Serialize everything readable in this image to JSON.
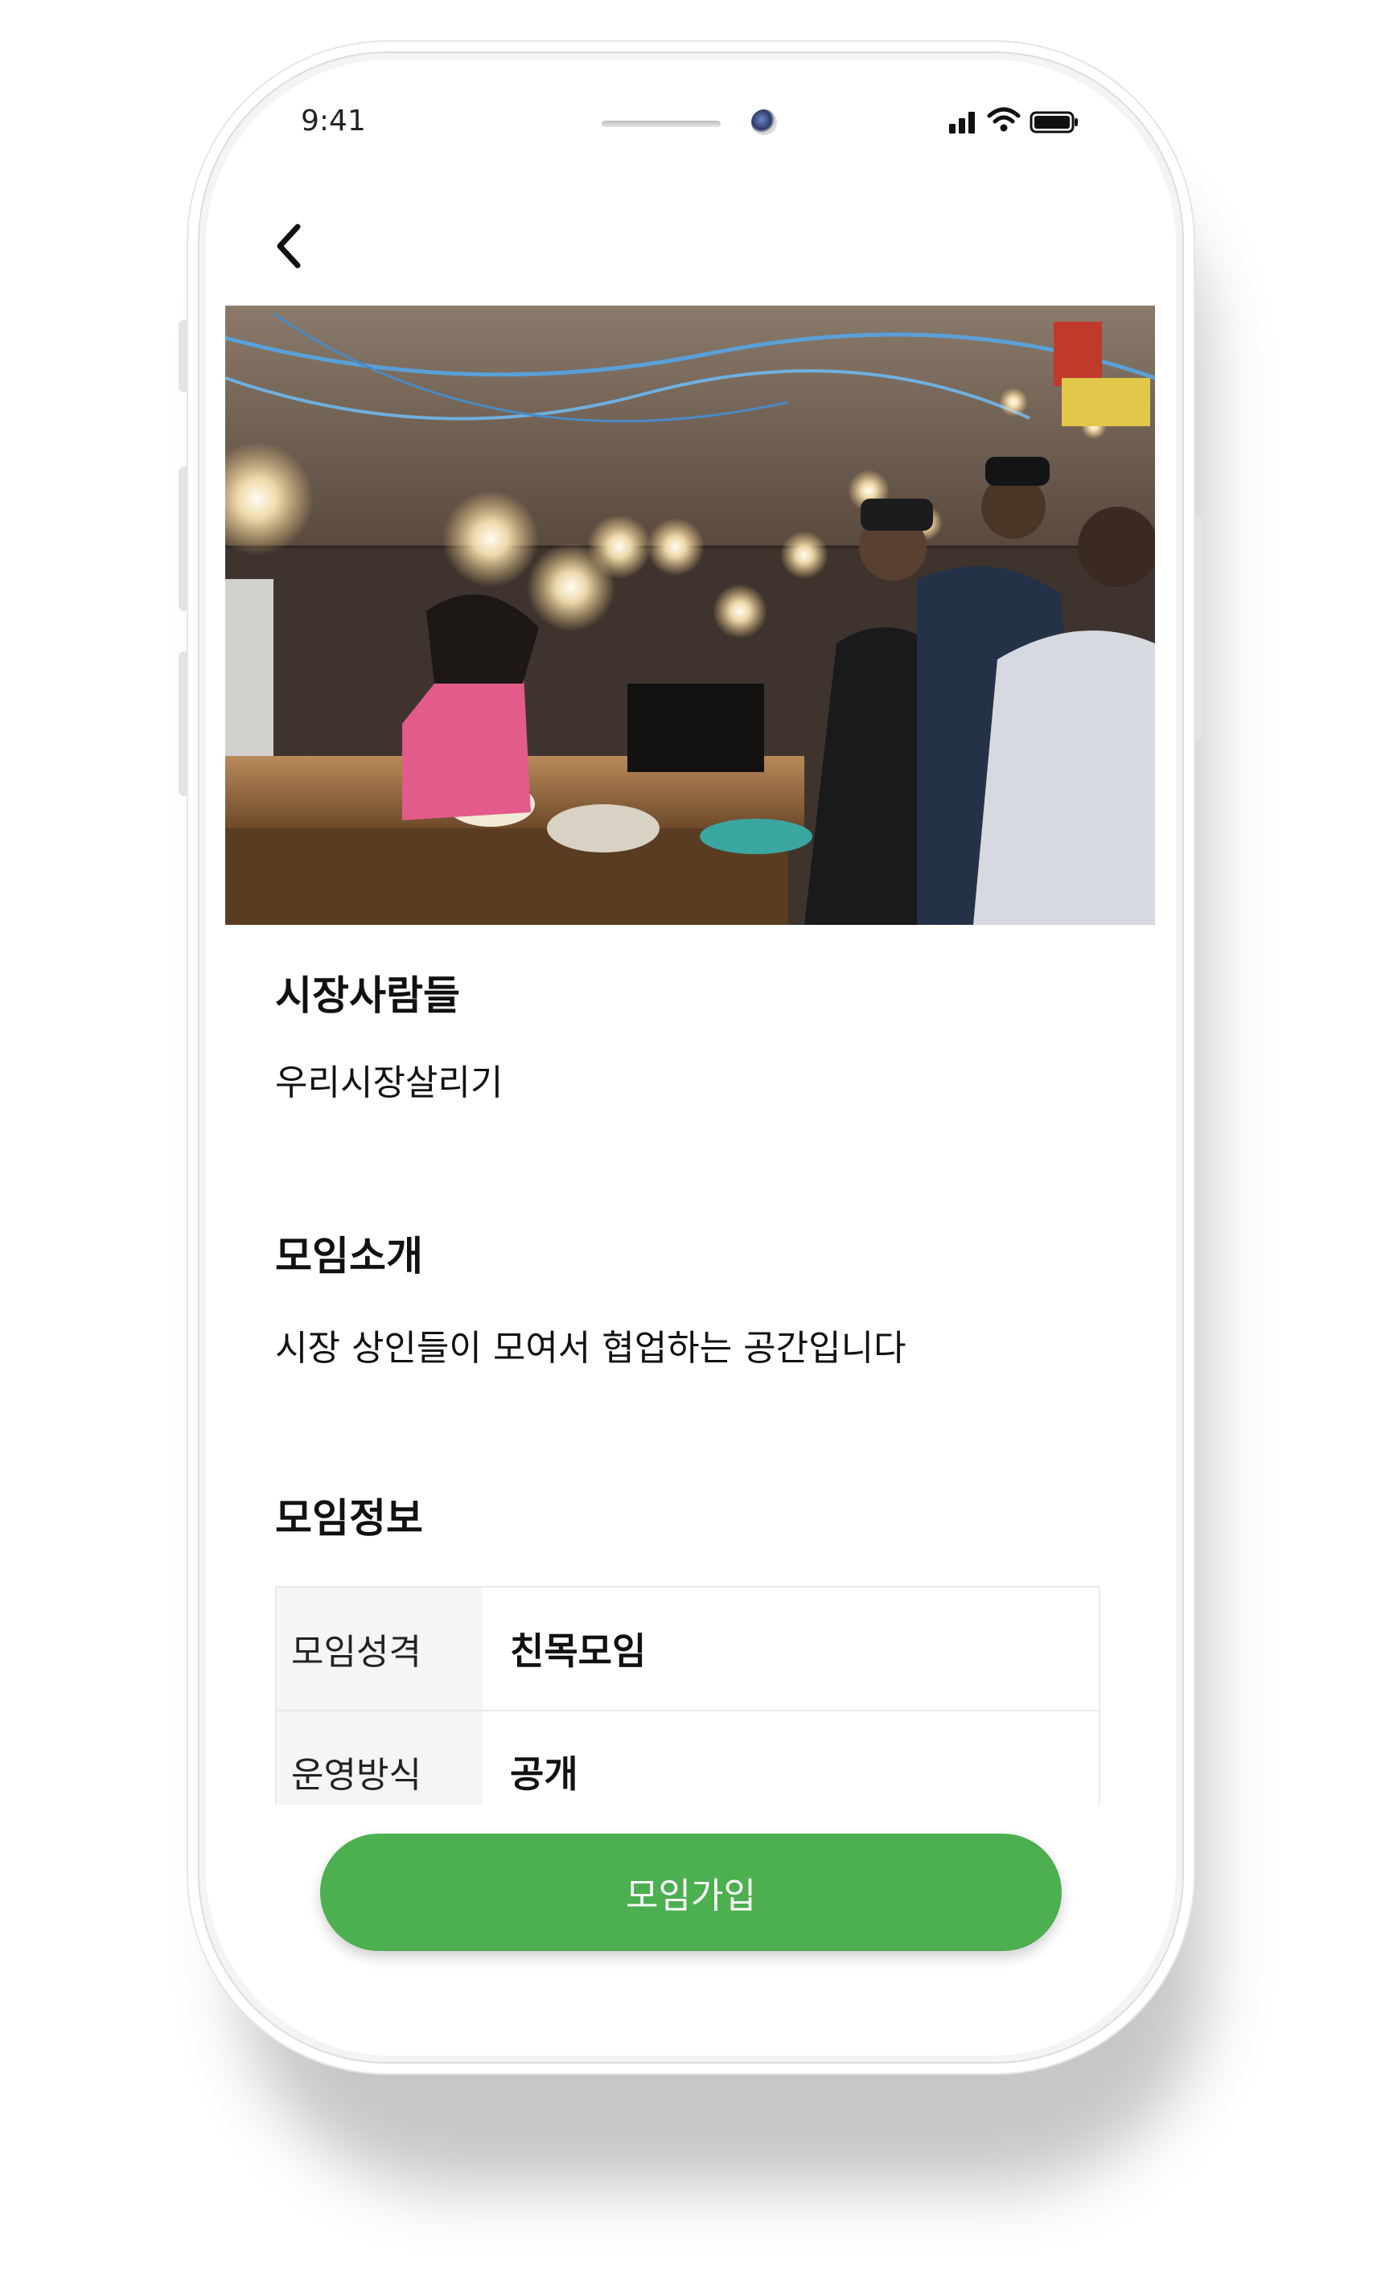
{
  "status_bar": {
    "time": "9:41",
    "icons": [
      "signal-icon",
      "wifi-icon",
      "battery-icon"
    ]
  },
  "nav": {
    "back_icon": "chevron-left-icon"
  },
  "hero": {
    "description_icon": "photo"
  },
  "group": {
    "name": "시장사람들",
    "tagline": "우리시장살리기"
  },
  "intro": {
    "heading": "모임소개",
    "text": "시장 상인들이 모여서 협업하는 공간입니다"
  },
  "info": {
    "heading": "모임정보",
    "rows": [
      {
        "key": "모임성격",
        "value": "친목모임"
      },
      {
        "key": "운영방식",
        "value": "공개"
      }
    ]
  },
  "actions": {
    "join_label": "모임가입"
  },
  "colors": {
    "accent": "#4caf50",
    "table_key_bg": "#f5f5f5"
  }
}
